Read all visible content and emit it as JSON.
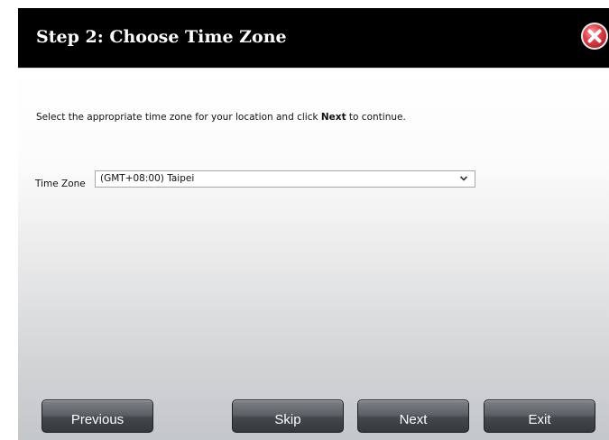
{
  "dialog": {
    "title": "Step 2: Choose Time Zone",
    "close_icon": "close-circle-x-icon"
  },
  "instruction": {
    "before": "Select the appropriate time zone for your location and click ",
    "bold": "Next",
    "after": " to continue."
  },
  "timezone": {
    "label": "Time Zone",
    "selected": "(GMT+08:00) Taipei",
    "dropdown_icon": "chevron-down-icon"
  },
  "buttons": {
    "previous": "Previous",
    "skip": "Skip",
    "next": "Next",
    "exit": "Exit"
  },
  "colors": {
    "title_bar": "#000000",
    "close_button": "#e0454e",
    "button_face": "#4a4f54"
  }
}
